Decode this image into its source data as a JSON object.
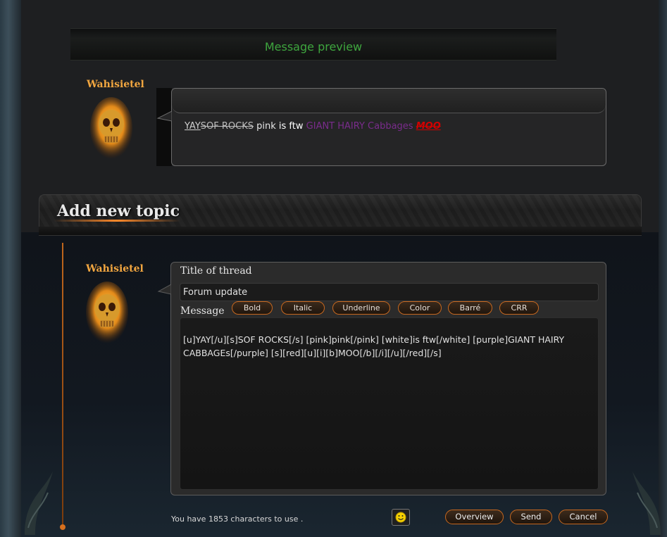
{
  "preview": {
    "banner_title": "Message preview",
    "username": "Wahisietel",
    "content": {
      "underline_text": "YAY",
      "strike_text": "SOF ROCKS",
      "pink_text": "pink",
      "white_text": "is ftw",
      "purple_text": "GIANT HAIRY Cabbages",
      "red_text": "MOO"
    }
  },
  "topic": {
    "header_title": "Add new topic",
    "username": "Wahisietel",
    "title_label": "Title of thread",
    "title_value": "Forum update",
    "message_label": "Message",
    "format_buttons": {
      "bold": "Bold",
      "italic": "Italic",
      "underline": "Underline",
      "color": "Color",
      "barre": "Barré",
      "crr": "CRR"
    },
    "message_value": "[u]YAY[/u][s]SOF ROCKS[/s] [pink]pink[/pink] [white]is ftw[/white] [purple]GIANT HAIRY CABBAGEs[/purple] [s][red][u][i][b]MOO[/b][/i][/u][/red][/s]",
    "char_count_text": "You have 1853 characters to use .",
    "actions": {
      "overview": "Overview",
      "send": "Send",
      "cancel": "Cancel"
    }
  },
  "icons": {
    "smiley": "smiley-icon",
    "avatar": "flaming-skull-avatar"
  },
  "colors": {
    "accent_orange": "#c7681f",
    "username": "#f1a640",
    "banner_green": "#3ea63e",
    "purple": "#7a2c8c",
    "red": "#d20000"
  }
}
